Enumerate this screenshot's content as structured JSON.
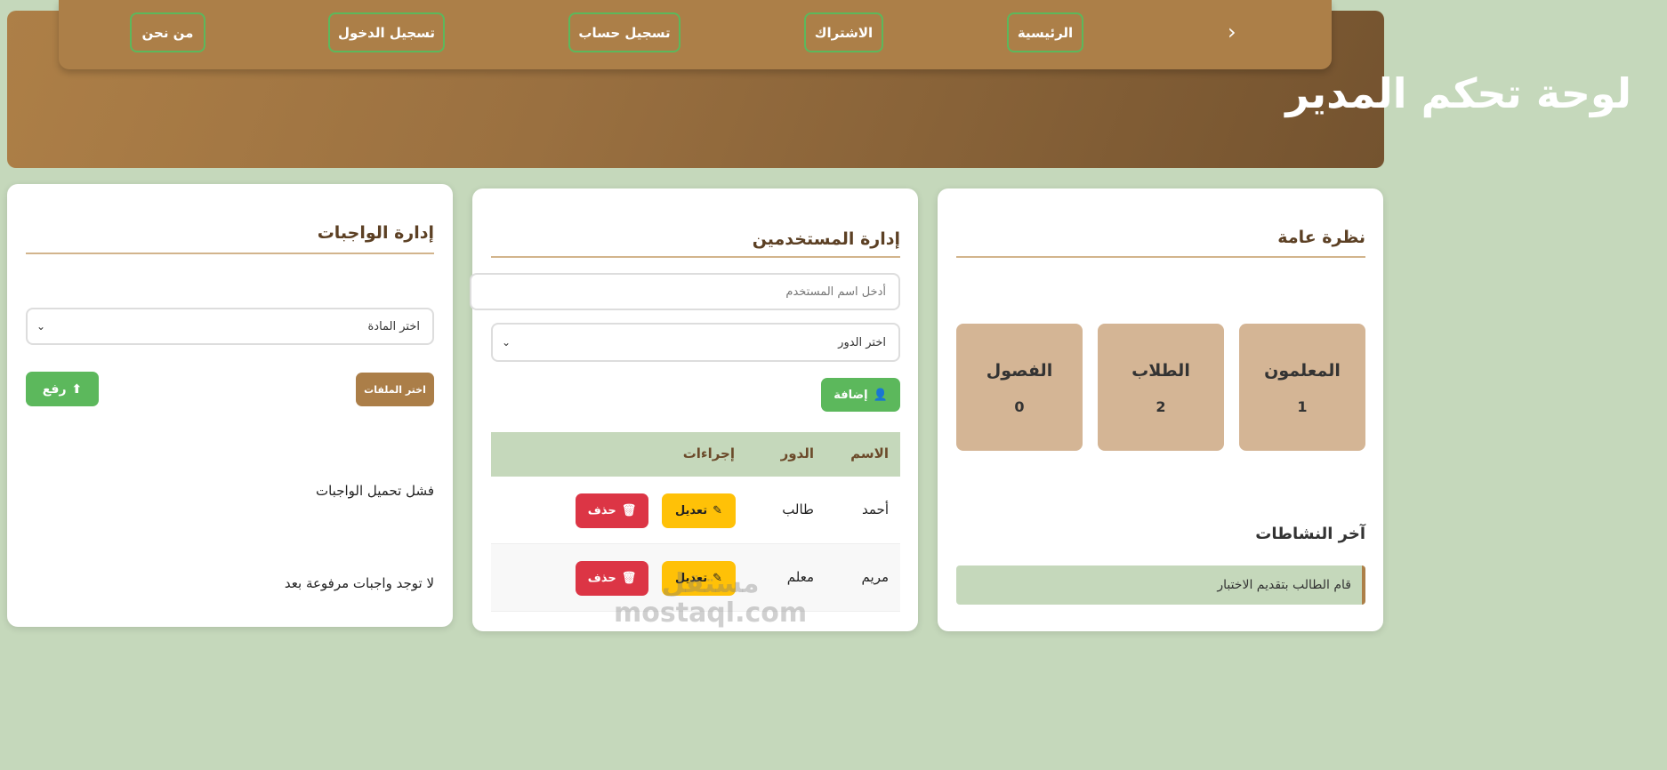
{
  "nav": {
    "items": [
      "الرئيسية",
      "الاشتراك",
      "تسجيل حساب",
      "تسجيل الدخول",
      "من نحن"
    ]
  },
  "header": {
    "title": "لوحة تحكم المدير"
  },
  "overview": {
    "title": "نظرة عامة",
    "stats": [
      {
        "label": "المعلمون",
        "value": "1"
      },
      {
        "label": "الطلاب",
        "value": "2"
      },
      {
        "label": "الفصول",
        "value": "0"
      }
    ],
    "activity_title": "آخر النشاطات",
    "activities": [
      "قام الطالب بتقديم الاختبار"
    ]
  },
  "users": {
    "title": "إدارة المستخدمين",
    "name_placeholder": "أدخل اسم المستخدم",
    "role_select": "اختر الدور",
    "add_label": "إضافة",
    "columns": [
      "الاسم",
      "الدور",
      "إجراءات"
    ],
    "rows": [
      {
        "name": "أحمد",
        "role": "طالب"
      },
      {
        "name": "مريم",
        "role": "معلم"
      }
    ],
    "edit_label": "تعديل",
    "delete_label": "حذف"
  },
  "assignments": {
    "title": "إدارة الواجبات",
    "subject_select": "اختر المادة",
    "choose_files": "اختر الملفات",
    "upload": "رفع",
    "error": "فشل تحميل الواجبات",
    "empty": "لا توجد واجبات مرفوعة بعد"
  },
  "watermark": "مستقل mostaql.com",
  "colors": {
    "accent": "#ac7f48",
    "green": "#5cb85c",
    "warning": "#ffc107",
    "danger": "#dc3545",
    "bg": "#c5d8bb"
  }
}
